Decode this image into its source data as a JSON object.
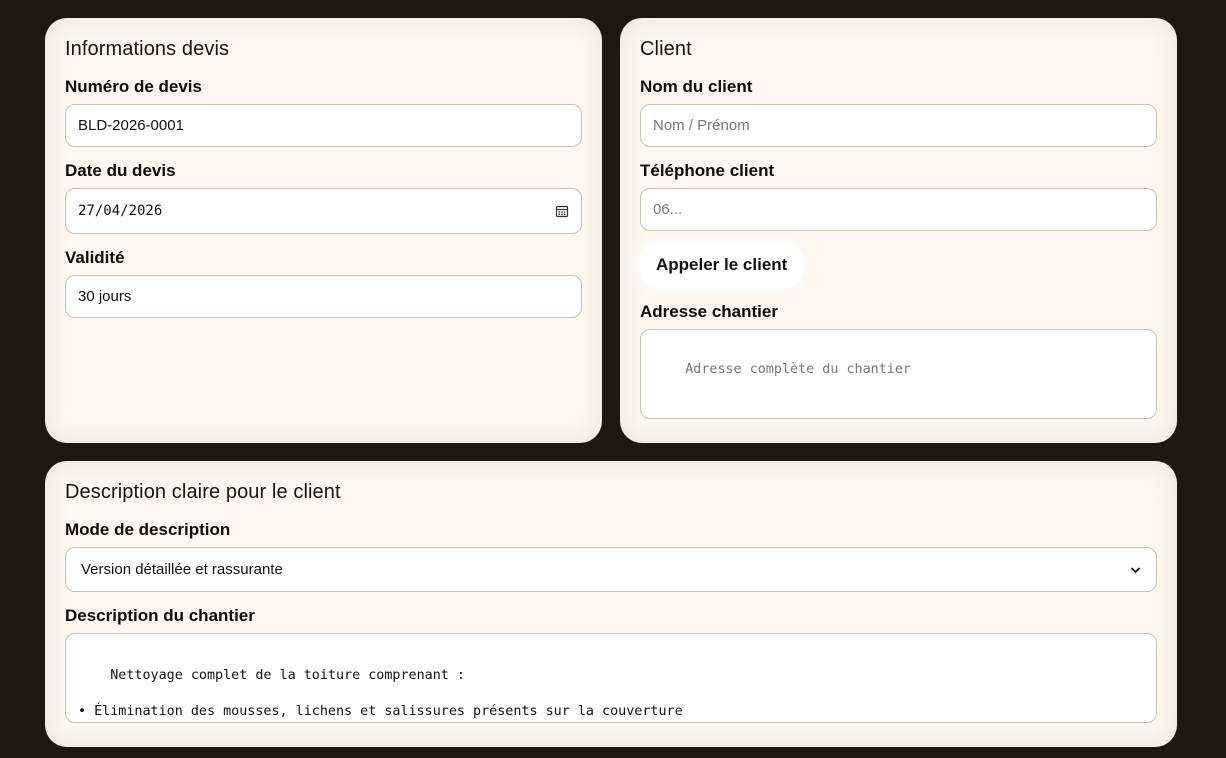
{
  "info_card": {
    "title": "Informations devis",
    "quote_number_label": "Numéro de devis",
    "quote_number_value": "BLD-2026-0001",
    "date_label": "Date du devis",
    "date_value": "27/04/2026",
    "validity_label": "Validité",
    "validity_value": "30 jours"
  },
  "client_card": {
    "title": "Client",
    "name_label": "Nom du client",
    "name_placeholder": "Nom / Prénom",
    "phone_label": "Téléphone client",
    "phone_placeholder": "06...",
    "call_button": "Appeler le client",
    "address_label": "Adresse chantier",
    "address_placeholder": "Adresse complète du chantier"
  },
  "description_card": {
    "title": "Description claire pour le client",
    "mode_label": "Mode de description",
    "mode_selected": "Version détaillée et rassurante",
    "description_label": "Description du chantier",
    "description_text": "Nettoyage complet de la toiture comprenant :\n\n• Élimination des mousses, lichens et salissures présents sur la couverture\n• Nettoyage adapté afin de préserver les matériaux de toiture"
  },
  "colors": {
    "background": "#1f1611",
    "card": "#fdf7f0",
    "border": "#c9c0b6"
  }
}
